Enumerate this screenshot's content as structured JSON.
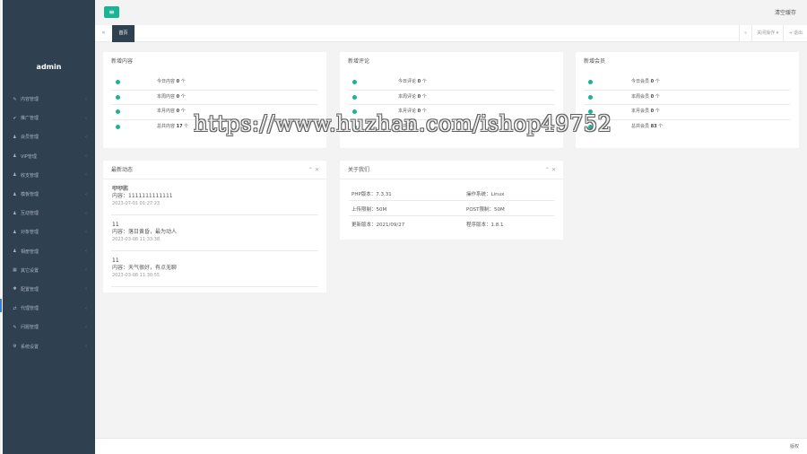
{
  "sidebar": {
    "username": "admin",
    "items": [
      {
        "icon": "✎",
        "icon_name": "edit-icon",
        "label": "内容管理"
      },
      {
        "icon": "✔",
        "icon_name": "check-icon",
        "label": "推广管理"
      },
      {
        "icon": "♟",
        "icon_name": "user-icon",
        "label": "会员管理"
      },
      {
        "icon": "♟",
        "icon_name": "user-icon",
        "label": "VIP管理"
      },
      {
        "icon": "♟",
        "icon_name": "user-icon",
        "label": "收支管理"
      },
      {
        "icon": "♟",
        "icon_name": "user-icon",
        "label": "模板管理"
      },
      {
        "icon": "♟",
        "icon_name": "user-icon",
        "label": "互动管理"
      },
      {
        "icon": "♟",
        "icon_name": "user-icon",
        "label": "对象管理"
      },
      {
        "icon": "♟",
        "icon_name": "user-icon",
        "label": "相册管理"
      },
      {
        "icon": "▦",
        "icon_name": "grid-icon",
        "label": "其它设置"
      },
      {
        "icon": "✱",
        "icon_name": "gear-icon",
        "label": "配置管理"
      },
      {
        "icon": "⇄",
        "icon_name": "exchange-icon",
        "label": "代理管理"
      },
      {
        "icon": "✎",
        "icon_name": "edit-icon",
        "label": "问题管理"
      },
      {
        "icon": "⚙",
        "icon_name": "cogs-icon",
        "label": "系统设置"
      }
    ]
  },
  "topbar": {
    "menu_icon": "≡",
    "clear_cache": "清空缓存"
  },
  "tabs": {
    "back_icon": "«",
    "active": "首页",
    "forward_icon": "»",
    "close_ops": "关闭操作 ▾",
    "logout": "⇥ 退出"
  },
  "stats": [
    {
      "title": "新增内容",
      "rows": [
        {
          "label": "今日内容",
          "value": "0",
          "unit": "个"
        },
        {
          "label": "本周内容",
          "value": "0",
          "unit": "个"
        },
        {
          "label": "本月内容",
          "value": "0",
          "unit": "个"
        },
        {
          "label": "总共内容",
          "value": "17",
          "unit": "个"
        }
      ]
    },
    {
      "title": "新增评论",
      "rows": [
        {
          "label": "今日评论",
          "value": "0",
          "unit": "个"
        },
        {
          "label": "本周评论",
          "value": "0",
          "unit": "个"
        },
        {
          "label": "本月评论",
          "value": "0",
          "unit": "个"
        },
        {
          "label": "总共评论",
          "value": "",
          "unit": ""
        }
      ]
    },
    {
      "title": "新增会员",
      "rows": [
        {
          "label": "今日会员",
          "value": "0",
          "unit": "个"
        },
        {
          "label": "本周会员",
          "value": "0",
          "unit": "个"
        },
        {
          "label": "本月会员",
          "value": "0",
          "unit": "个"
        },
        {
          "label": "总共会员",
          "value": "83",
          "unit": "个"
        }
      ]
    }
  ],
  "news": {
    "title": "最新动态",
    "tools": "⌃ ✕",
    "items": [
      {
        "title": "咿咿鹏",
        "content": "内容：1111111111111",
        "time": "2023-07-01 01:27:23"
      },
      {
        "title": "11",
        "content": "内容：落日黄昏，最为动人",
        "time": "2023-03-08 11:33:38"
      },
      {
        "title": "11",
        "content": "内容：天气很好，有点无聊",
        "time": "2023-03-08 11:30:55"
      }
    ]
  },
  "about": {
    "title": "关于我们",
    "tools": "⌃ ✕",
    "rows": [
      {
        "left": "PHP版本：7.3.31",
        "right": "操作系统：Linux"
      },
      {
        "left": "上传限制：50M",
        "right": "POST限制：50M"
      },
      {
        "left": "更新版本：2021/09/27",
        "right": "程序版本：1.8.1"
      }
    ]
  },
  "footer": {
    "text": "版权"
  },
  "watermark": "https://www.huzhan.com/ishop49752"
}
